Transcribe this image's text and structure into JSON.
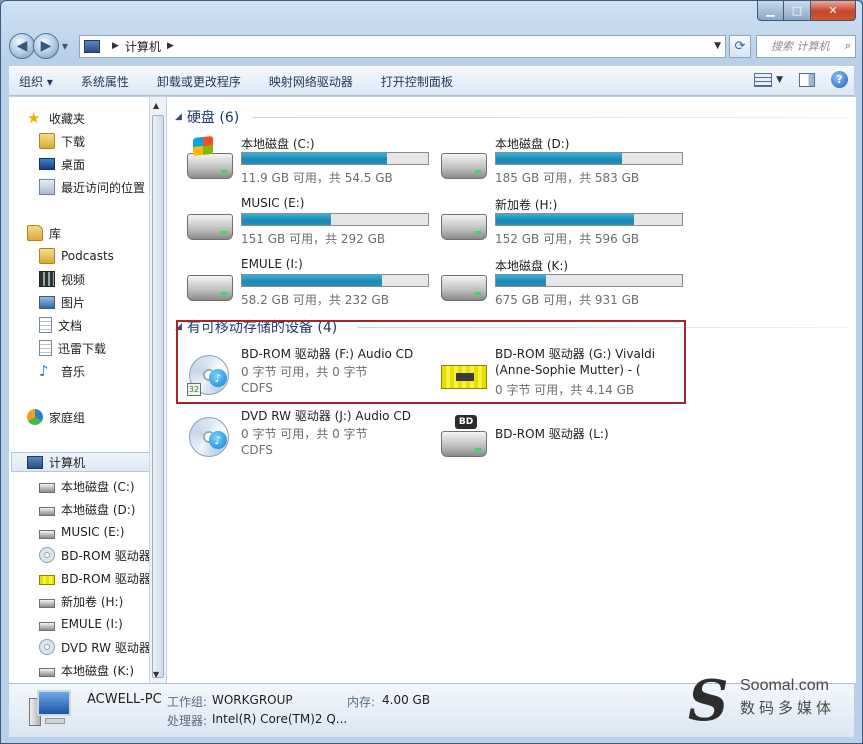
{
  "window": {
    "minimize": "▁",
    "maximize": "□",
    "close": "✕"
  },
  "navigation": {
    "address_path": [
      "计算机"
    ],
    "search_placeholder": "搜索 计算机"
  },
  "toolbar": {
    "organize": "组织 ▾",
    "system_properties": "系统属性",
    "uninstall": "卸载或更改程序",
    "map_drive": "映射网络驱动器",
    "control_panel": "打开控制面板",
    "help": "?"
  },
  "sidebar": {
    "favorites": "收藏夹",
    "downloads": "下载",
    "desktop": "桌面",
    "recent": "最近访问的位置",
    "libraries": "库",
    "podcasts": "Podcasts",
    "videos": "视频",
    "pictures": "图片",
    "documents": "文档",
    "thunder": "迅雷下载",
    "music": "音乐",
    "homegroup": "家庭组",
    "computer": "计算机",
    "drives": [
      "本地磁盘 (C:)",
      "本地磁盘 (D:)",
      "MUSIC (E:)",
      "BD-ROM 驱动器",
      "BD-ROM 驱动器",
      "新加卷 (H:)",
      "EMULE (I:)",
      "DVD RW 驱动器",
      "本地磁盘 (K:)"
    ]
  },
  "main": {
    "hdd_group": "硬盘 (6)",
    "removable_group": "有可移动存储的设备 (4)",
    "hdds": [
      {
        "name": "本地磁盘 (C:)",
        "info": "11.9 GB 可用，共 54.5 GB",
        "used_fraction": 0.78
      },
      {
        "name": "本地磁盘 (D:)",
        "info": "185 GB 可用，共 583 GB",
        "used_fraction": 0.68
      },
      {
        "name": "MUSIC (E:)",
        "info": "151 GB 可用，共 292 GB",
        "used_fraction": 0.48
      },
      {
        "name": "新加卷 (H:)",
        "info": "152 GB 可用，共 596 GB",
        "used_fraction": 0.74
      },
      {
        "name": "EMULE (I:)",
        "info": "58.2 GB 可用，共 232 GB",
        "used_fraction": 0.75
      },
      {
        "name": "本地磁盘 (K:)",
        "info": "675 GB 可用，共 931 GB",
        "used_fraction": 0.27
      }
    ],
    "removable": [
      {
        "name": "BD-ROM 驱动器 (F:) Audio CD",
        "info": "0 字节 可用，共 0 字节",
        "fs": "CDFS"
      },
      {
        "name": "BD-ROM 驱动器 (G:) Vivaldi",
        "name2": "(Anne-Sophie Mutter) - (",
        "info": "0 字节 可用，共 4.14 GB"
      },
      {
        "name": "DVD RW 驱动器 (J:) Audio CD",
        "info": "0 字节 可用，共 0 字节",
        "fs": "CDFS"
      },
      {
        "name": "BD-ROM 驱动器 (L:)",
        "bd_label": "BD"
      }
    ]
  },
  "status": {
    "computer_name": "ACWELL-PC",
    "workgroup_label": "工作组:",
    "workgroup": "WORKGROUP",
    "memory_label": "内存:",
    "memory": "4.00 GB",
    "processor_label": "处理器:",
    "processor": "Intel(R) Core(TM)2 Q..."
  },
  "watermark": {
    "logo_letter": "S",
    "site": "Soomal.com",
    "slogan": "数码多媒体"
  }
}
